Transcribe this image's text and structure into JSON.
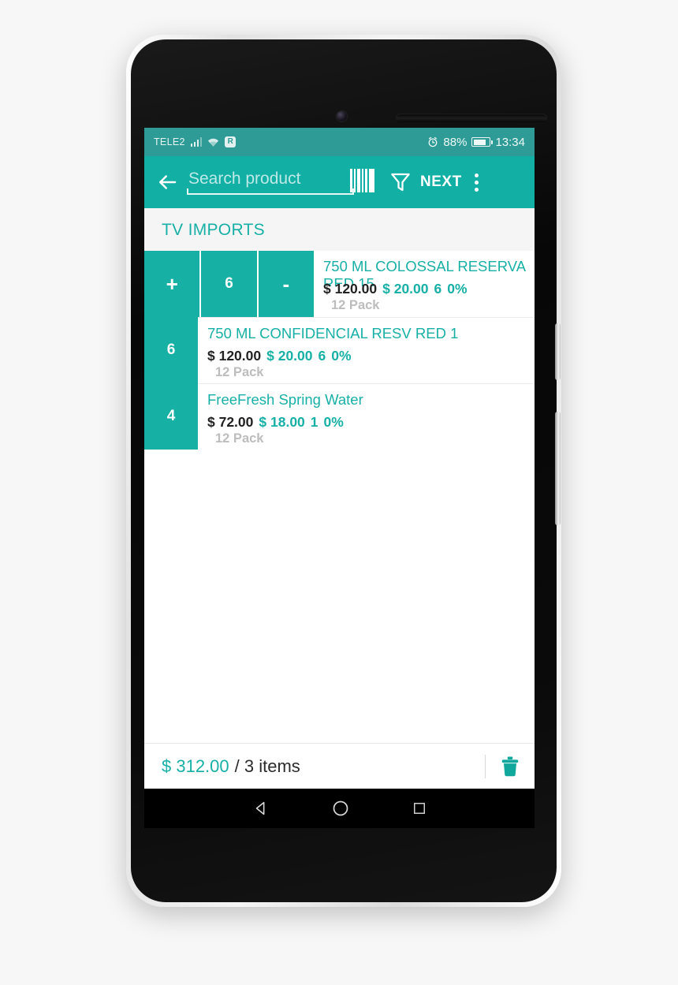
{
  "status_bar": {
    "carrier": "TELE2",
    "signal_icon": "signal-bars-icon",
    "wifi_icon": "wifi-icon",
    "roaming_icon": "R",
    "alarm_icon": "alarm-clock-icon",
    "battery_percent": "88%",
    "battery_icon": "battery-icon",
    "time": "13:34",
    "background": "#2e9b96"
  },
  "app_bar": {
    "back_icon": "arrow-left-icon",
    "search_placeholder": "Search product",
    "search_value": "",
    "barcode_icon": "barcode-scan-icon",
    "filter_icon": "filter-funnel-icon",
    "next_label": "NEXT",
    "overflow_icon": "more-vertical-icon",
    "background": "#12afa5"
  },
  "section": {
    "title": "TV IMPORTS"
  },
  "stepper": {
    "plus_label": "+",
    "minus_label": "-",
    "quantity": "6"
  },
  "rows": [
    {
      "name": "750 ML COLOSSAL RESERVA RED 15",
      "total": "$ 120.00",
      "unit_price": "$ 20.00",
      "quantity": "6",
      "discount": "0%",
      "pack": "12 Pack",
      "qty_badge": "6",
      "expanded": true
    },
    {
      "name": "750 ML CONFIDENCIAL RESV RED 1",
      "total": "$ 120.00",
      "unit_price": "$ 20.00",
      "quantity": "6",
      "discount": "0%",
      "pack": "12 Pack",
      "qty_badge": "6",
      "expanded": false
    },
    {
      "name": "FreeFresh Spring Water",
      "total": "$ 72.00",
      "unit_price": "$ 18.00",
      "quantity": "1",
      "discount": "0%",
      "pack": "12 Pack",
      "qty_badge": "4",
      "expanded": false
    }
  ],
  "footer": {
    "total": "$ 312.00",
    "items": "/ 3 items",
    "delete_icon": "trash-icon"
  },
  "nav_bar": {
    "back_icon": "nav-back-triangle-icon",
    "home_icon": "nav-home-circle-icon",
    "recents_icon": "nav-recents-square-icon"
  },
  "theme": {
    "accent": "#18b0a6",
    "app_bar": "#12afa5",
    "status_bar": "#2e9b96",
    "section_bg": "#f5f5f5",
    "muted": "#bdbdbd"
  }
}
